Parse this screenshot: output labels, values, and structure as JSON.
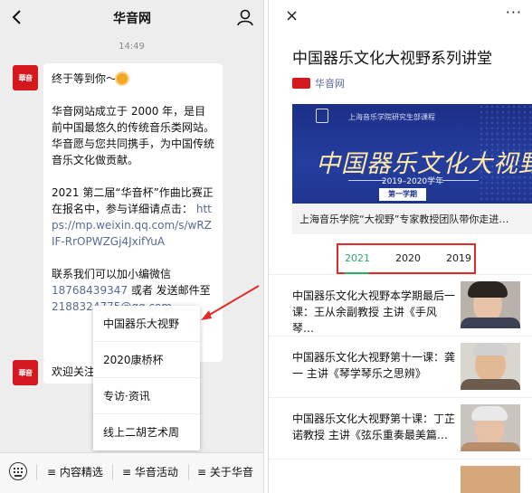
{
  "left": {
    "title": "华音网",
    "time": "14:49",
    "avatar_text": "華音",
    "message": {
      "greeting": "终于等到你～",
      "intro": "华音网站成立于 2000 年，是目前中国最悠久的传统音乐类网站。华音愿与您共同携手，为中国传统音乐文化做贡献。",
      "contest": "2021 第二届“华音杯”作曲比赛正在报名中，参与详细请点击：",
      "contest_link": "https://mp.weixin.qq.com/s/wRZIF-RrOPWZGj4JxifYuA",
      "contact_a": "联系我们可以加小编微信",
      "wechat": "18768439347",
      "contact_b": "或者 发送邮件至",
      "email": "2188324775@qq.com"
    },
    "welcome": "欢迎关注",
    "popup_items": [
      "中国器乐大视野",
      "2020康桥杯",
      "专访·资讯",
      "线上二胡艺术周"
    ],
    "bottom_menu": [
      "≡ 内容精选",
      "≡ 华音活动",
      "≡ 关于华音"
    ]
  },
  "right": {
    "close_glyph": "×",
    "more_glyph": "···",
    "title": "中国器乐文化大视野系列讲堂",
    "source": "华音网",
    "banner": {
      "subtitle": "上海音乐学院研究生部课程",
      "headline": "中国器乐文化大视野",
      "years": "2019–2020学年",
      "term": "第一学期"
    },
    "caption": "上海音乐学院“大视野”专家教授团队带你走进…",
    "year_tabs": [
      "2021",
      "2020",
      "2019"
    ],
    "articles": [
      "中国器乐文化大视野本学期最后一课：王从余副教授 主讲《手风琴…",
      "中国器乐文化大视野第十一课：龚一 主讲《琴学琴乐之思辨》",
      "中国器乐文化大视野第十课：丁芷诺教授 主讲《弦乐重奏最美篇…"
    ]
  },
  "colors": {
    "brand_red": "#d4181d",
    "link": "#576b95",
    "tab_active": "#2aae67",
    "highlight": "#e02b2b",
    "banner_blue": "#1e348f"
  }
}
